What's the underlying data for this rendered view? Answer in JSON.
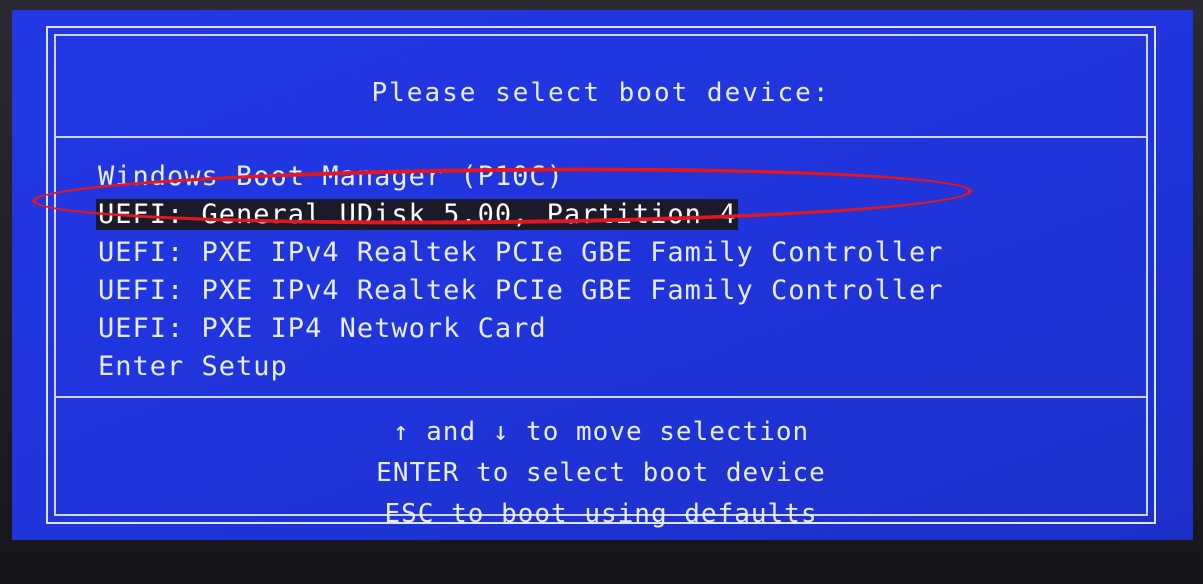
{
  "boot_menu": {
    "title": "Please select boot device:",
    "items": [
      {
        "label": "Windows Boot Manager (P10C)",
        "selected": false
      },
      {
        "label": "UEFI: General UDisk 5.00, Partition 4",
        "selected": true
      },
      {
        "label": "UEFI: PXE IPv4 Realtek PCIe GBE Family Controller",
        "selected": false
      },
      {
        "label": "UEFI: PXE IPv4 Realtek PCIe GBE Family Controller",
        "selected": false
      },
      {
        "label": "UEFI: PXE IP4 Network Card",
        "selected": false
      },
      {
        "label": "Enter Setup",
        "selected": false
      }
    ],
    "help": {
      "line1": "↑ and ↓ to move selection",
      "line2": "ENTER to select boot device",
      "line3": "ESC to boot using defaults"
    }
  },
  "colors": {
    "background": "#1f35dc",
    "text": "#e8ecff",
    "highlight": "#1a1a2a",
    "annotation": "#e4171c"
  }
}
